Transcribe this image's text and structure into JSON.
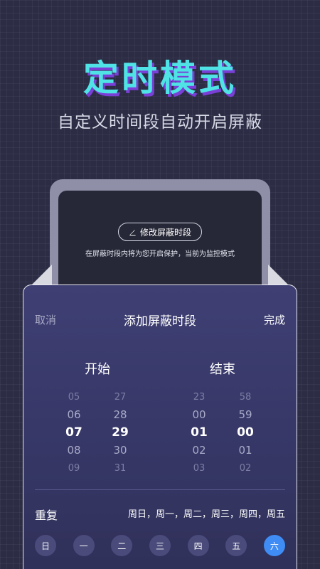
{
  "hero": {
    "title": "定时模式",
    "subtitle": "自定义时间段自动开启屏蔽"
  },
  "phone": {
    "edit_button": "修改屏蔽时段",
    "note": "在屏蔽时段内将为您开启保护，当前为监控模式"
  },
  "sheet": {
    "cancel": "取消",
    "title": "添加屏蔽时段",
    "done": "完成",
    "start_label": "开始",
    "end_label": "结束",
    "start_hour": [
      "05",
      "06",
      "07",
      "08",
      "09"
    ],
    "start_minute": [
      "27",
      "28",
      "29",
      "30",
      "31"
    ],
    "end_hour": [
      "23",
      "00",
      "01",
      "02",
      "03"
    ],
    "end_minute": [
      "58",
      "59",
      "00",
      "01",
      "02"
    ],
    "repeat_label": "重复",
    "repeat_value": "周日，周一，周二，周三，周四，周五",
    "days": [
      "日",
      "一",
      "二",
      "三",
      "四",
      "五",
      "六"
    ],
    "active_day": "六"
  },
  "colors": {
    "accent": "#3f8cf5",
    "title": "#4fe3e6",
    "title_shadow": "#7a3fd6"
  }
}
